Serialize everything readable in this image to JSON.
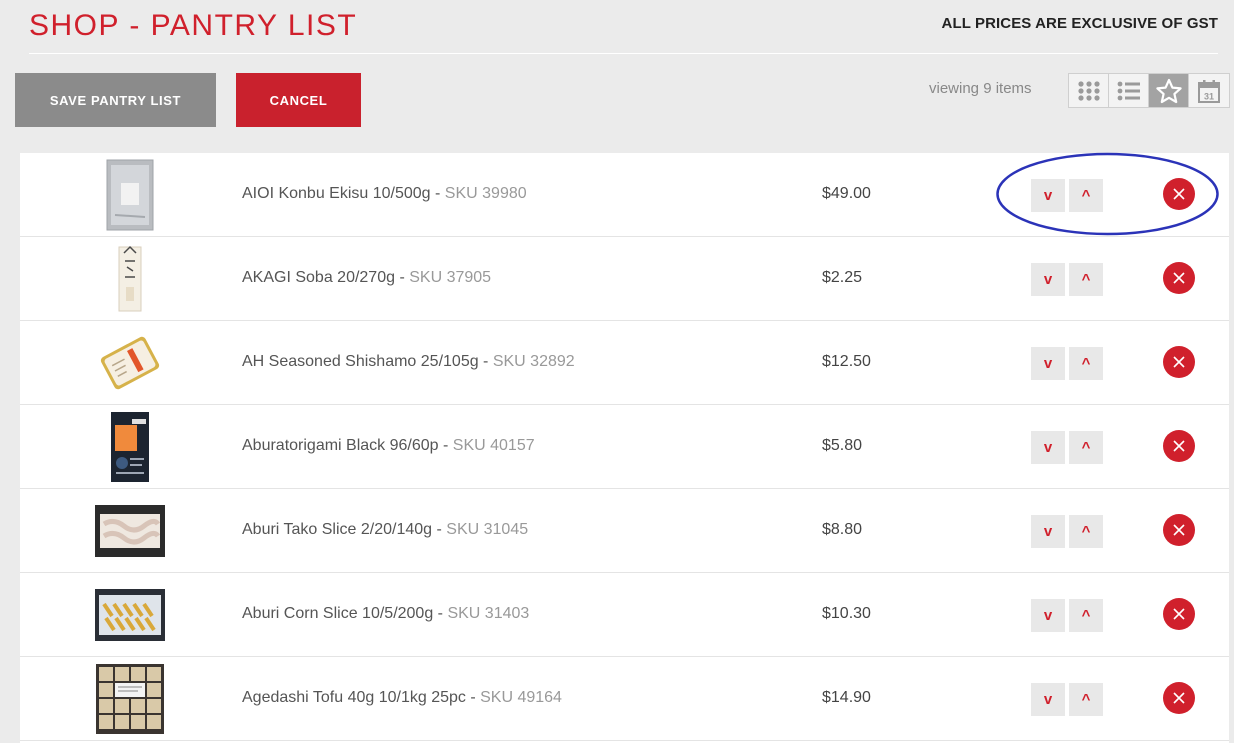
{
  "header": {
    "title": "SHOP - PANTRY LIST",
    "gst_note": "ALL PRICES ARE EXCLUSIVE OF GST"
  },
  "actions": {
    "save_label": "SAVE PANTRY LIST",
    "cancel_label": "CANCEL"
  },
  "viewing": {
    "label": "viewing",
    "count": "9 items"
  },
  "view_modes": [
    {
      "icon": "grid-icon",
      "active": false
    },
    {
      "icon": "list-icon",
      "active": false
    },
    {
      "icon": "star-icon",
      "active": true
    },
    {
      "icon": "calendar-icon",
      "active": false
    }
  ],
  "items": [
    {
      "name": "AIOI Konbu Ekisu 10/500g",
      "sku": "SKU 39980",
      "price": "$49.00",
      "move_down": "v",
      "move_up": "^"
    },
    {
      "name": "AKAGI Soba 20/270g",
      "sku": "SKU 37905",
      "price": "$2.25",
      "move_down": "v",
      "move_up": "^"
    },
    {
      "name": "AH Seasoned Shishamo 25/105g",
      "sku": "SKU 32892",
      "price": "$12.50",
      "move_down": "v",
      "move_up": "^"
    },
    {
      "name": "Aburatorigami Black 96/60p",
      "sku": "SKU 40157",
      "price": "$5.80",
      "move_down": "v",
      "move_up": "^"
    },
    {
      "name": "Aburi Tako Slice 2/20/140g",
      "sku": "SKU 31045",
      "price": "$8.80",
      "move_down": "v",
      "move_up": "^"
    },
    {
      "name": "Aburi Corn Slice 10/5/200g",
      "sku": "SKU 31403",
      "price": "$10.30",
      "move_down": "v",
      "move_up": "^"
    },
    {
      "name": "Agedashi Tofu 40g 10/1kg 25pc",
      "sku": "SKU 49164",
      "price": "$14.90",
      "move_down": "v",
      "move_up": "^"
    }
  ],
  "colors": {
    "brand_red": "#d0202c",
    "save_gray": "#8b8b8b",
    "annotation_blue": "#2b33b8"
  }
}
